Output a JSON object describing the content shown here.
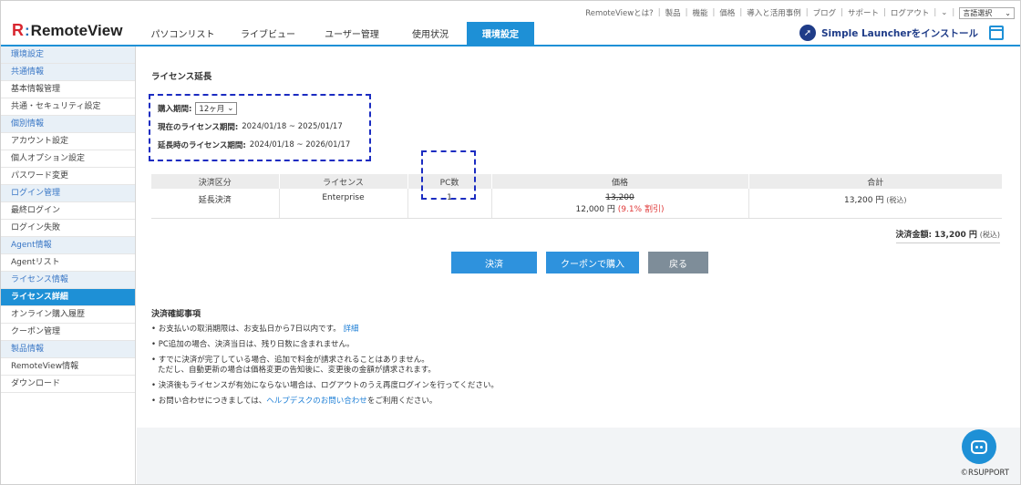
{
  "topbar": {
    "links": [
      "RemoteViewとは?",
      "製品",
      "機能",
      "価格",
      "導入と活用事例",
      "ブログ",
      "サポート",
      "ログアウト"
    ],
    "lang_label": "言語選択"
  },
  "header": {
    "logo_mark": "R",
    "logo_colon": ":",
    "logo_text": "RemoteView",
    "tabs": [
      {
        "label": "パソコンリスト",
        "active": false
      },
      {
        "label": "ライブビュー",
        "active": false
      },
      {
        "label": "ユーザー管理",
        "active": false
      },
      {
        "label": "使用状況",
        "active": false
      },
      {
        "label": "環境設定",
        "active": true
      }
    ],
    "launcher_label": "Simple Launcherをインストール"
  },
  "sidebar": {
    "items": [
      {
        "label": "環境設定",
        "type": "head"
      },
      {
        "label": "共通情報",
        "type": "head"
      },
      {
        "label": "基本情報管理",
        "type": "item"
      },
      {
        "label": "共通・セキュリティ設定",
        "type": "item"
      },
      {
        "label": "個別情報",
        "type": "head"
      },
      {
        "label": "アカウント設定",
        "type": "item"
      },
      {
        "label": "個人オプション設定",
        "type": "item"
      },
      {
        "label": "パスワード変更",
        "type": "item"
      },
      {
        "label": "ログイン管理",
        "type": "head"
      },
      {
        "label": "最終ログイン",
        "type": "item"
      },
      {
        "label": "ログイン失敗",
        "type": "item"
      },
      {
        "label": "Agent情報",
        "type": "head"
      },
      {
        "label": "Agentリスト",
        "type": "item"
      },
      {
        "label": "ライセンス情報",
        "type": "head"
      },
      {
        "label": "ライセンス詳細",
        "type": "active"
      },
      {
        "label": "オンライン購入履歴",
        "type": "item"
      },
      {
        "label": "クーポン管理",
        "type": "item"
      },
      {
        "label": "製品情報",
        "type": "head"
      },
      {
        "label": "RemoteView情報",
        "type": "item"
      },
      {
        "label": "ダウンロード",
        "type": "item"
      }
    ]
  },
  "main": {
    "title": "ライセンス延長",
    "period_label": "購入期間:",
    "period_value": "12ヶ月",
    "current_label": "現在のライセンス期間:",
    "current_value": "2024/01/18 ~ 2025/01/17",
    "extended_label": "延長時のライセンス期間:",
    "extended_value": "2024/01/18 ~ 2026/01/17",
    "table": {
      "headers": [
        "決済区分",
        "ライセンス",
        "PC数",
        "価格",
        "合計"
      ],
      "row": {
        "type": "延長決済",
        "license": "Enterprise",
        "pc_count": "1",
        "old_price": "13,200",
        "new_price": "12,000 円",
        "discount": "(9.1% 割引)",
        "total": "13,200 円",
        "total_tax": "(税込)"
      }
    },
    "payment_label": "決済金額:",
    "payment_amount": "13,200 円",
    "payment_tax": "(税込)",
    "buttons": {
      "pay": "決済",
      "coupon": "クーポンで購入",
      "back": "戻る"
    },
    "notes_title": "決済確認事項",
    "notes": {
      "n1": "• お支払いの取消期限は、お支払日から7日以内です。",
      "n1_link": "詳細",
      "n2": "• PC追加の場合、決済当日は、残り日数に含まれません。",
      "n3a": "• すでに決済が完了している場合、追加で料金が請求されることはありません。",
      "n3b": "ただし、自動更新の場合は価格変更の告知後に、変更後の金額が請求されます。",
      "n4": "• 決済後もライセンスが有効にならない場合は、ログアウトのうえ再度ログインを行ってください。",
      "n5_pre": "• お問い合わせにつきましては、",
      "n5_link": "ヘルプデスクのお問い合わせ",
      "n5_post": "をご利用ください。"
    }
  },
  "footer": {
    "copyright": "©RSUPPORT"
  },
  "icons": {
    "rocket": "rocket-icon",
    "window": "window-icon",
    "chatbot": "chatbot-icon",
    "chevron": "chevron-down-icon"
  },
  "colors": {
    "accent": "#1e90d6",
    "annotation": "#1b2cc1",
    "discount": "#e03a3a",
    "brand_red": "#d8262f"
  }
}
